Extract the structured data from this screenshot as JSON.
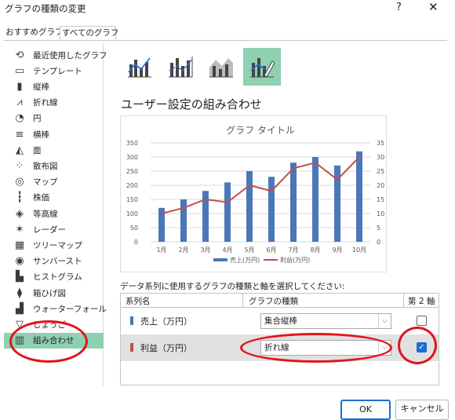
{
  "window": {
    "title": "グラフの種類の変更",
    "help": "?",
    "close": "✕"
  },
  "tabs": [
    {
      "label": "おすすめグラフ"
    },
    {
      "label": "すべてのグラフ"
    }
  ],
  "sidebar": {
    "items": [
      {
        "label": "最近使用したグラフ",
        "icon": "recent-icon"
      },
      {
        "label": "テンプレート",
        "icon": "template-icon"
      },
      {
        "label": "縦棒",
        "icon": "column-chart-icon"
      },
      {
        "label": "折れ線",
        "icon": "line-chart-icon"
      },
      {
        "label": "円",
        "icon": "pie-chart-icon"
      },
      {
        "label": "横棒",
        "icon": "bar-chart-icon"
      },
      {
        "label": "面",
        "icon": "area-chart-icon"
      },
      {
        "label": "散布図",
        "icon": "scatter-chart-icon"
      },
      {
        "label": "マップ",
        "icon": "map-chart-icon"
      },
      {
        "label": "株価",
        "icon": "stock-chart-icon"
      },
      {
        "label": "等高線",
        "icon": "surface-chart-icon"
      },
      {
        "label": "レーダー",
        "icon": "radar-chart-icon"
      },
      {
        "label": "ツリーマップ",
        "icon": "treemap-icon"
      },
      {
        "label": "サンバースト",
        "icon": "sunburst-icon"
      },
      {
        "label": "ヒストグラム",
        "icon": "histogram-icon"
      },
      {
        "label": "箱ひげ図",
        "icon": "boxplot-icon"
      },
      {
        "label": "ウォーターフォール",
        "icon": "waterfall-icon"
      },
      {
        "label": "じょうご",
        "icon": "funnel-icon"
      },
      {
        "label": "組み合わせ",
        "icon": "combo-chart-icon",
        "selected": true
      }
    ]
  },
  "combo": {
    "title": "ユーザー設定の組み合わせ",
    "prompt": "データ系列に使用するグラフの種類と軸を選択してください:",
    "headers": {
      "series": "系列名",
      "type": "グラフの種類",
      "secondary": "第 2 軸"
    },
    "rows": [
      {
        "name": "売上（万円）",
        "type": "集合縦棒",
        "secondary": false,
        "color": "#4a77b8"
      },
      {
        "name": "利益（万円）",
        "type": "折れ線",
        "secondary": true,
        "color": "#c0504d"
      }
    ]
  },
  "chart_data": {
    "type": "bar",
    "title": "グラフ タイトル",
    "categories": [
      "1月",
      "2月",
      "3月",
      "4月",
      "5月",
      "6月",
      "7月",
      "8月",
      "9月",
      "10月"
    ],
    "series": [
      {
        "name": "売上(万円)",
        "type": "bar",
        "axis": "primary",
        "color": "#4a77b8",
        "values": [
          120,
          150,
          180,
          210,
          250,
          230,
          280,
          300,
          270,
          320
        ]
      },
      {
        "name": "利益(万円)",
        "type": "line",
        "axis": "secondary",
        "color": "#c0504d",
        "values": [
          10,
          12,
          15,
          14,
          20,
          18,
          26,
          28,
          22,
          30
        ]
      }
    ],
    "ylim": [
      0,
      350
    ],
    "y2lim": [
      0,
      35
    ],
    "yticks": [
      0,
      50,
      100,
      150,
      200,
      250,
      300,
      350
    ],
    "y2ticks": [
      0,
      5,
      10,
      15,
      20,
      25,
      30,
      35
    ],
    "legend": "bottom",
    "grid": true
  },
  "buttons": {
    "ok": "OK",
    "cancel": "キャンセル"
  },
  "colors": {
    "accent": "#1a6fd1",
    "selection": "#8fd0b0",
    "highlight": "#e3131b"
  }
}
